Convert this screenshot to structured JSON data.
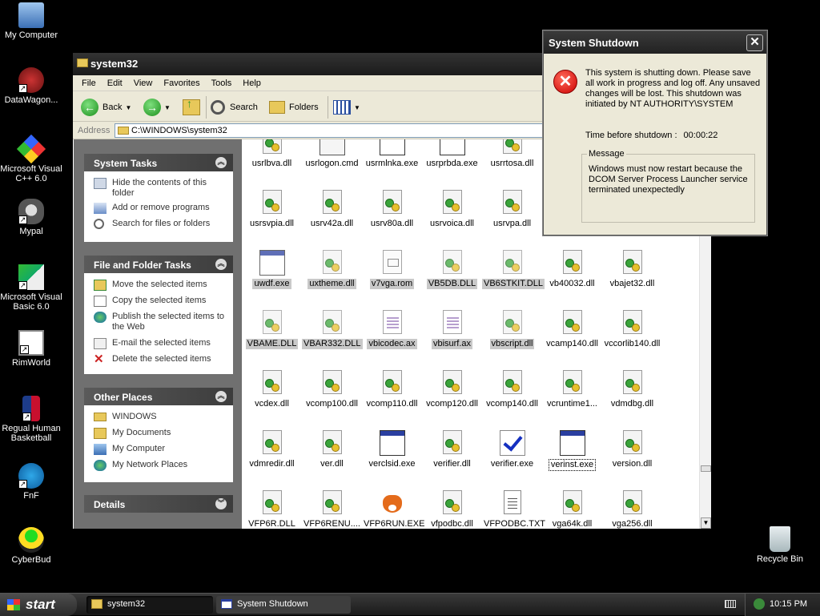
{
  "desktop": {
    "icons": [
      {
        "name": "desktop-icon-my-computer",
        "label": "My Computer"
      },
      {
        "name": "desktop-icon-datawagon",
        "label": "DataWagon..."
      },
      {
        "name": "desktop-icon-visual-cpp",
        "label": "Microsoft Visual C++ 6.0"
      },
      {
        "name": "desktop-icon-mypal",
        "label": "Mypal"
      },
      {
        "name": "desktop-icon-visual-basic",
        "label": "Microsoft Visual Basic 6.0"
      },
      {
        "name": "desktop-icon-rimworld",
        "label": "RimWorld"
      },
      {
        "name": "desktop-icon-regual-human-basketball",
        "label": "Regual Human Basketball"
      },
      {
        "name": "desktop-icon-fnf",
        "label": "FnF"
      },
      {
        "name": "desktop-icon-cyberbud",
        "label": "CyberBud"
      },
      {
        "name": "desktop-icon-recycle-bin",
        "label": "Recycle Bin"
      }
    ]
  },
  "explorer": {
    "title": "system32",
    "menu": [
      "File",
      "Edit",
      "View",
      "Favorites",
      "Tools",
      "Help"
    ],
    "toolbar": {
      "back": "Back",
      "search": "Search",
      "folders": "Folders"
    },
    "address": {
      "label": "Address",
      "value": "C:\\WINDOWS\\system32"
    },
    "system_tasks": {
      "title": "System Tasks",
      "items": [
        "Hide the contents of this folder",
        "Add or remove programs",
        "Search for files or folders"
      ]
    },
    "file_tasks": {
      "title": "File and Folder Tasks",
      "items": [
        "Move the selected items",
        "Copy the selected items",
        "Publish the selected items to the Web",
        "E-mail the selected items",
        "Delete the selected items"
      ]
    },
    "other_places": {
      "title": "Other Places",
      "items": [
        "WINDOWS",
        "My Documents",
        "My Computer",
        "My Network Places"
      ]
    },
    "details": {
      "title": "Details"
    },
    "files": [
      {
        "n": "usrlbva.dll",
        "t": "dll"
      },
      {
        "n": "usrlogon.cmd",
        "t": "cmd"
      },
      {
        "n": "usrmlnka.exe",
        "t": "exe"
      },
      {
        "n": "usrprbda.exe",
        "t": "exe"
      },
      {
        "n": "usrrtosa.dll",
        "t": "dll"
      },
      {
        "n": "",
        "t": "none"
      },
      {
        "n": "",
        "t": "none"
      },
      {
        "n": "usrsvpia.dll",
        "t": "dll"
      },
      {
        "n": "usrv42a.dll",
        "t": "dll"
      },
      {
        "n": "usrv80a.dll",
        "t": "dll"
      },
      {
        "n": "usrvoica.dll",
        "t": "dll"
      },
      {
        "n": "usrvpa.dll",
        "t": "dll"
      },
      {
        "n": "",
        "t": "none"
      },
      {
        "n": "",
        "t": "none"
      },
      {
        "n": "uwdf.exe",
        "t": "exe",
        "sel": true
      },
      {
        "n": "uxtheme.dll",
        "t": "dll",
        "sel": true
      },
      {
        "n": "v7vga.rom",
        "t": "rom",
        "sel": true
      },
      {
        "n": "VB5DB.DLL",
        "t": "dll",
        "sel": true
      },
      {
        "n": "VB6STKIT.DLL",
        "t": "dll",
        "sel": true
      },
      {
        "n": "vb40032.dll",
        "t": "dll"
      },
      {
        "n": "vbajet32.dll",
        "t": "dll"
      },
      {
        "n": "VBAME.DLL",
        "t": "dll",
        "sel": true
      },
      {
        "n": "VBAR332.DLL",
        "t": "dll",
        "sel": true
      },
      {
        "n": "vbicodec.ax",
        "t": "ax",
        "sel": true
      },
      {
        "n": "vbisurf.ax",
        "t": "ax",
        "sel": true
      },
      {
        "n": "vbscript.dll",
        "t": "dll",
        "sel": true
      },
      {
        "n": "vcamp140.dll",
        "t": "dll"
      },
      {
        "n": "vccorlib140.dll",
        "t": "dll"
      },
      {
        "n": "vcdex.dll",
        "t": "dll"
      },
      {
        "n": "vcomp100.dll",
        "t": "dll"
      },
      {
        "n": "vcomp110.dll",
        "t": "dll"
      },
      {
        "n": "vcomp120.dll",
        "t": "dll"
      },
      {
        "n": "vcomp140.dll",
        "t": "dll"
      },
      {
        "n": "vcruntime1...",
        "t": "dll"
      },
      {
        "n": "vdmdbg.dll",
        "t": "dll"
      },
      {
        "n": "vdmredir.dll",
        "t": "dll"
      },
      {
        "n": "ver.dll",
        "t": "dll"
      },
      {
        "n": "verclsid.exe",
        "t": "exe"
      },
      {
        "n": "verifier.dll",
        "t": "dll"
      },
      {
        "n": "verifier.exe",
        "t": "check"
      },
      {
        "n": "verinst.exe",
        "t": "exe",
        "focus": true
      },
      {
        "n": "version.dll",
        "t": "dll"
      },
      {
        "n": "VFP6R.DLL",
        "t": "dll"
      },
      {
        "n": "VFP6RENU....",
        "t": "dll"
      },
      {
        "n": "VFP6RUN.EXE",
        "t": "fox"
      },
      {
        "n": "vfpodbc.dll",
        "t": "dll"
      },
      {
        "n": "VFPODBC.TXT",
        "t": "txt"
      },
      {
        "n": "vga64k.dll",
        "t": "dll"
      },
      {
        "n": "vga256.dll",
        "t": "dll"
      }
    ]
  },
  "dialog": {
    "title": "System Shutdown",
    "message": "This system is shutting down. Please save all work in progress and log off. Any unsaved changes will be lost. This shutdown was initiated by NT AUTHORITY\\SYSTEM",
    "timer_label": "Time before shutdown :",
    "timer_value": "00:00:22",
    "message_label": "Message",
    "message_text": "Windows must now restart because the DCOM Server Process Launcher service terminated unexpectedly"
  },
  "taskbar": {
    "start": "start",
    "buttons": [
      "system32",
      "System Shutdown"
    ],
    "clock": "10:15 PM"
  }
}
